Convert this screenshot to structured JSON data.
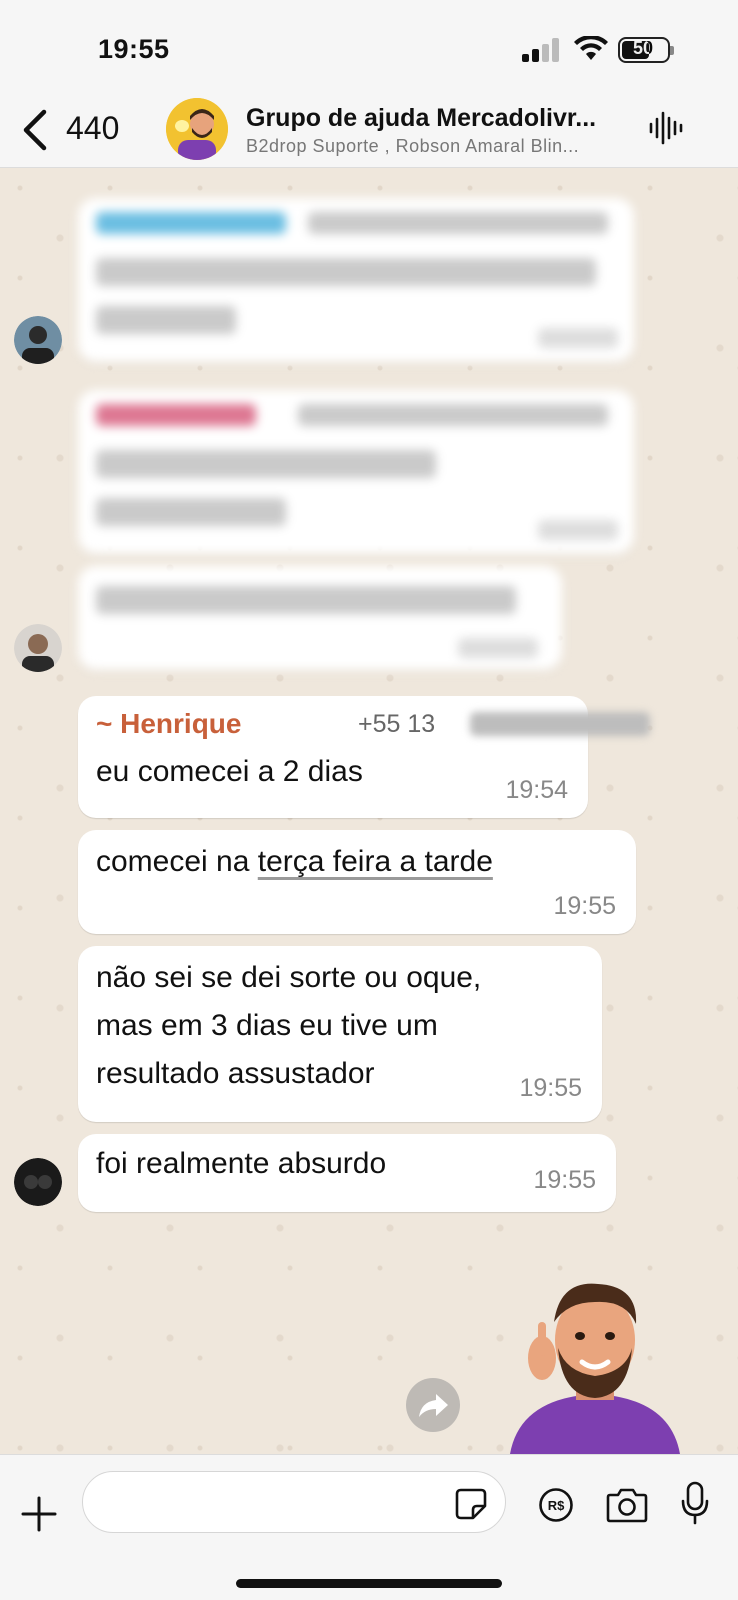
{
  "status_bar": {
    "time": "19:55",
    "battery": "50"
  },
  "header": {
    "back_count": "440",
    "title": "Grupo de ajuda Mercadolivr...",
    "members": "B2drop Suporte , Robson Amaral Blin..."
  },
  "messages": [
    {
      "sender": "~ Henrique",
      "phone": "+55 13",
      "text": "eu comecei a 2 dias",
      "time": "19:54"
    },
    {
      "text": "comecei na ",
      "text_link": "terça feira a tarde",
      "time": "19:55"
    },
    {
      "lines": [
        "não sei se dei sorte ou oque,",
        "mas em 3 dias eu tive um",
        "resultado assustador"
      ],
      "time": "19:55"
    },
    {
      "text": "foi realmente absurdo",
      "time": "19:55"
    }
  ],
  "composer": {
    "placeholder": ""
  },
  "colors": {
    "sender_name": "#c8603a",
    "chat_bg": "#efe7dc",
    "bubble": "#ffffff"
  }
}
